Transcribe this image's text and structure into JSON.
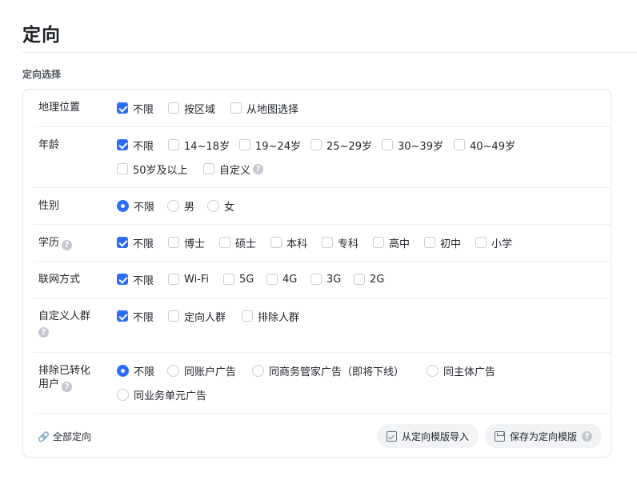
{
  "page_title": "定向",
  "section_label": "定向选择",
  "rows": {
    "geo": {
      "label": "地理位置",
      "options": [
        "不限",
        "按区域",
        "从地图选择"
      ]
    },
    "age": {
      "label": "年龄",
      "options": [
        "不限",
        "14~18岁",
        "19~24岁",
        "25~29岁",
        "30~39岁",
        "40~49岁",
        "50岁及以上",
        "自定义"
      ]
    },
    "gender": {
      "label": "性别",
      "options": [
        "不限",
        "男",
        "女"
      ]
    },
    "edu": {
      "label": "学历",
      "options": [
        "不限",
        "博士",
        "硕士",
        "本科",
        "专科",
        "高中",
        "初中",
        "小学"
      ]
    },
    "network": {
      "label": "联网方式",
      "options": [
        "不限",
        "Wi-Fi",
        "5G",
        "4G",
        "3G",
        "2G"
      ]
    },
    "audience": {
      "label": "自定义人群",
      "options": [
        "不限",
        "定向人群",
        "排除人群"
      ]
    },
    "exclude": {
      "label_line1": "排除已转化",
      "label_line2": "用户",
      "options": [
        "不限",
        "同账户广告",
        "同商务管家广告（即将下线）",
        "同主体广告",
        "同业务单元广告"
      ]
    }
  },
  "footer": {
    "all_targeting": "全部定向",
    "import_button": "从定向模版导入",
    "save_button": "保存为定向模版"
  },
  "colors": {
    "accent": "#2c6cf6",
    "border": "#e3e5e8",
    "text": "#1f2329"
  },
  "icons": [
    "checkbox-checked",
    "checkbox-empty",
    "radio-selected",
    "radio-empty",
    "help-circle-icon",
    "link-icon",
    "import-icon",
    "save-icon"
  ]
}
